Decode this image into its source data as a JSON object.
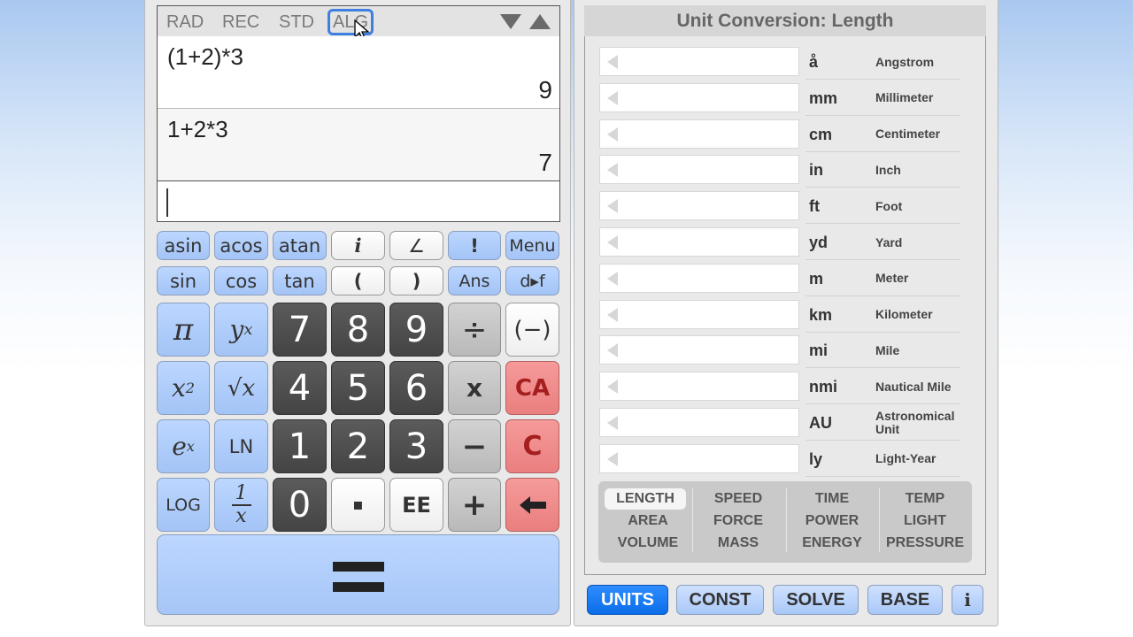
{
  "calculator": {
    "modes": [
      "RAD",
      "REC",
      "STD",
      "ALG"
    ],
    "active_mode": "ALG",
    "history": [
      {
        "expression": "(1+2)*3",
        "result": "9"
      },
      {
        "expression": "1+2*3",
        "result": "7"
      }
    ],
    "input": "",
    "keys_small_row1": [
      "asin",
      "acos",
      "atan",
      "i",
      "∠",
      "!",
      "Menu"
    ],
    "keys_small_row2": [
      "sin",
      "cos",
      "tan",
      "(",
      ")",
      "Ans",
      "d▸f"
    ],
    "keys": {
      "pi": "π",
      "power": "y",
      "power_sup": "x",
      "square": "x",
      "square_sup": "2",
      "sqrt": "√x",
      "exp": "e",
      "exp_sup": "x",
      "ln": "LN",
      "log": "LOG",
      "recip_num": "1",
      "recip_den": "x",
      "d7": "7",
      "d8": "8",
      "d9": "9",
      "d4": "4",
      "d5": "5",
      "d6": "6",
      "d1": "1",
      "d2": "2",
      "d3": "3",
      "d0": "0",
      "dot": "▪",
      "ee": "EE",
      "divide": "÷",
      "multiply": "x",
      "minus": "−",
      "plus": "+",
      "negate": "(−)",
      "clear_all": "CA",
      "clear": "C",
      "backspace": "🡐"
    }
  },
  "units": {
    "title": "Unit Conversion: Length",
    "rows": [
      {
        "abbr": "å",
        "name": "Angstrom"
      },
      {
        "abbr": "mm",
        "name": "Millimeter"
      },
      {
        "abbr": "cm",
        "name": "Centimeter"
      },
      {
        "abbr": "in",
        "name": "Inch"
      },
      {
        "abbr": "ft",
        "name": "Foot"
      },
      {
        "abbr": "yd",
        "name": "Yard"
      },
      {
        "abbr": "m",
        "name": "Meter"
      },
      {
        "abbr": "km",
        "name": "Kilometer"
      },
      {
        "abbr": "mi",
        "name": "Mile"
      },
      {
        "abbr": "nmi",
        "name": "Nautical Mile"
      },
      {
        "abbr": "AU",
        "name": "Astronomical Unit"
      },
      {
        "abbr": "ly",
        "name": "Light-Year"
      }
    ],
    "categories": [
      [
        "LENGTH",
        "AREA",
        "VOLUME"
      ],
      [
        "SPEED",
        "FORCE",
        "MASS"
      ],
      [
        "TIME",
        "POWER",
        "ENERGY"
      ],
      [
        "TEMP",
        "LIGHT",
        "PRESSURE"
      ]
    ],
    "active_category": "LENGTH"
  },
  "bottom_tabs": [
    "UNITS",
    "CONST",
    "SOLVE",
    "BASE",
    "i"
  ],
  "active_tab": "UNITS",
  "colors": {
    "accent": "#0b6ee8",
    "key_blue": "#a3c4f6",
    "key_red": "#ea7f7f",
    "key_dark": "#444444"
  }
}
